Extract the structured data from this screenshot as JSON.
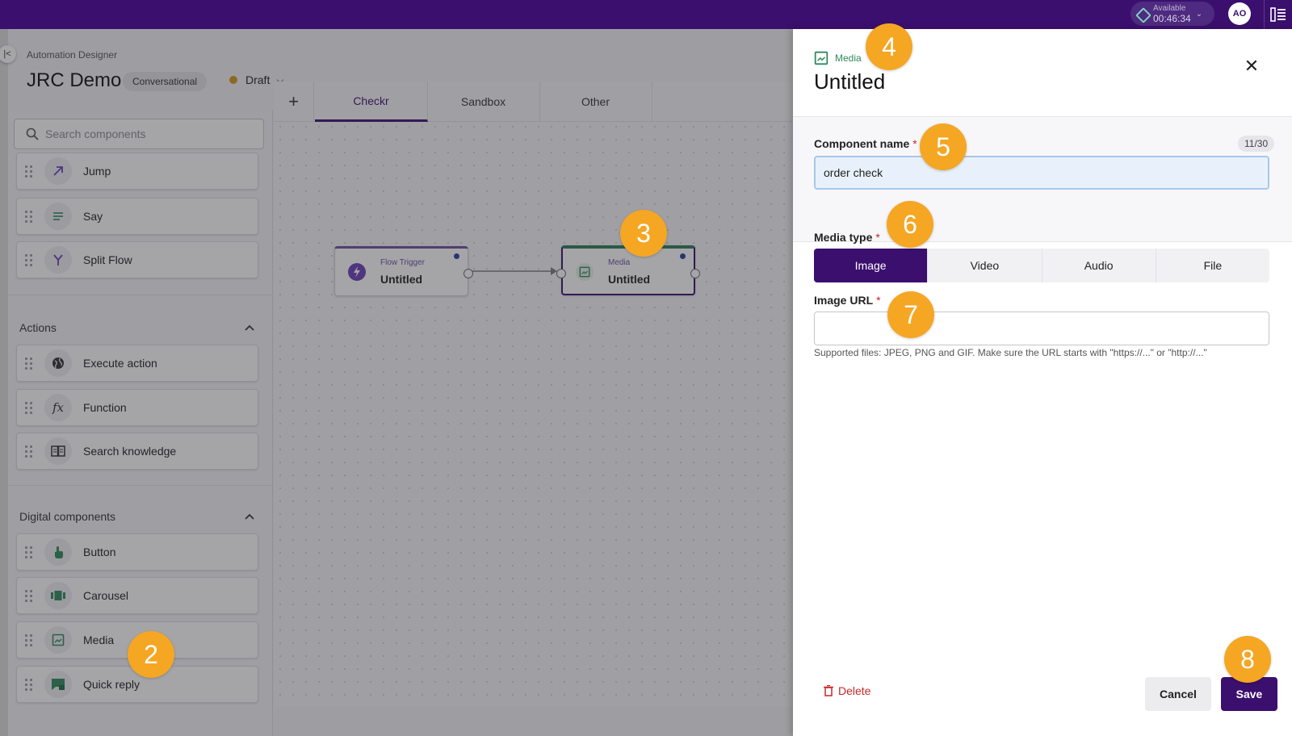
{
  "topbar": {
    "status_label": "Available",
    "status_time": "00:46:34",
    "avatar_initials": "AO"
  },
  "header": {
    "breadcrumb": "Automation Designer",
    "title": "JRC Demo",
    "badge": "Conversational",
    "status": "Draft"
  },
  "sidebar": {
    "search_placeholder": "Search components",
    "top_items": [
      {
        "label": "Jump",
        "icon": "jump-arrow-icon"
      },
      {
        "label": "Say",
        "icon": "say-lines-icon"
      },
      {
        "label": "Split Flow",
        "icon": "split-flow-icon"
      }
    ],
    "sections": [
      {
        "title": "Actions",
        "items": [
          {
            "label": "Execute action",
            "icon": "globe-icon"
          },
          {
            "label": "Function",
            "icon": "function-icon"
          },
          {
            "label": "Search knowledge",
            "icon": "book-icon"
          }
        ]
      },
      {
        "title": "Digital components",
        "items": [
          {
            "label": "Button",
            "icon": "tap-icon"
          },
          {
            "label": "Carousel",
            "icon": "carousel-icon"
          },
          {
            "label": "Media",
            "icon": "image-icon"
          },
          {
            "label": "Quick reply",
            "icon": "quick-reply-icon"
          }
        ]
      }
    ]
  },
  "canvas": {
    "tabs": [
      "Checkr",
      "Sandbox",
      "Other"
    ],
    "active_tab": "Checkr",
    "nodes": [
      {
        "type": "Flow Trigger",
        "title": "Untitled"
      },
      {
        "type": "Media",
        "title": "Untitled"
      }
    ]
  },
  "panel": {
    "type_label": "Media",
    "title": "Untitled",
    "component_name_label": "Component name",
    "component_name_value": "order check",
    "char_count": "11/30",
    "media_type_label": "Media type",
    "media_types": [
      "Image",
      "Video",
      "Audio",
      "File"
    ],
    "selected_media_type": "Image",
    "image_url_label": "Image URL",
    "image_url_value": "",
    "help_text": "Supported files: JPEG, PNG and GIF. Make sure the URL starts with \"https://...\" or \"http://...\"",
    "delete_label": "Delete",
    "cancel_label": "Cancel",
    "save_label": "Save"
  },
  "markers": [
    "2",
    "3",
    "4",
    "5",
    "6",
    "7",
    "8"
  ],
  "colors": {
    "brand": "#3b0f6e",
    "marker": "#f5a623",
    "media_green": "#2e8b5a",
    "danger": "#c62828"
  }
}
